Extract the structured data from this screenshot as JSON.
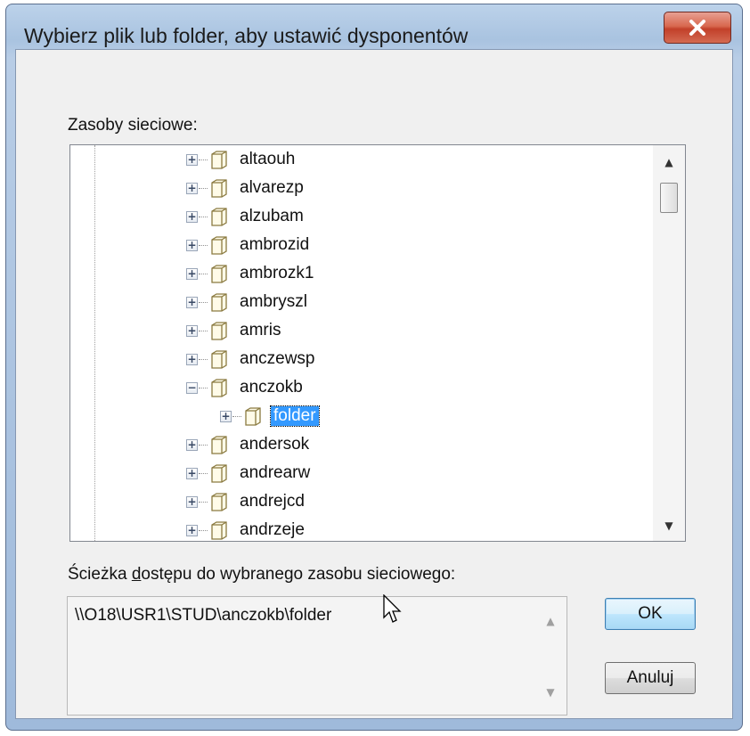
{
  "window": {
    "title": "Wybierz plik lub folder, aby ustawić dysponentów"
  },
  "tree": {
    "label": "Zasoby sieciowe:",
    "items": [
      {
        "label": "altaouh",
        "expander": "+"
      },
      {
        "label": "alvarezp",
        "expander": "+"
      },
      {
        "label": "alzubam",
        "expander": "+"
      },
      {
        "label": "ambrozid",
        "expander": "+"
      },
      {
        "label": "ambrozk1",
        "expander": "+"
      },
      {
        "label": "ambryszl",
        "expander": "+"
      },
      {
        "label": "amris",
        "expander": "+"
      },
      {
        "label": "anczewsp",
        "expander": "+"
      },
      {
        "label": "anczokb",
        "expander": "−"
      },
      {
        "label": "folder",
        "expander": "+"
      },
      {
        "label": "andersok",
        "expander": "+"
      },
      {
        "label": "andrearw",
        "expander": "+"
      },
      {
        "label": "andrejcd",
        "expander": "+"
      },
      {
        "label": "andrzeje",
        "expander": "+"
      }
    ]
  },
  "path": {
    "label_pre": "Ścieżka ",
    "label_accel": "d",
    "label_post": "ostępu do wybranego zasobu sieciowego:",
    "value": "\\\\O18\\USR1\\STUD\\anczokb\\folder"
  },
  "buttons": {
    "ok": "OK",
    "cancel": "Anuluj"
  },
  "colors": {
    "selection": "#3399ff",
    "close_button": "#c2402a"
  }
}
